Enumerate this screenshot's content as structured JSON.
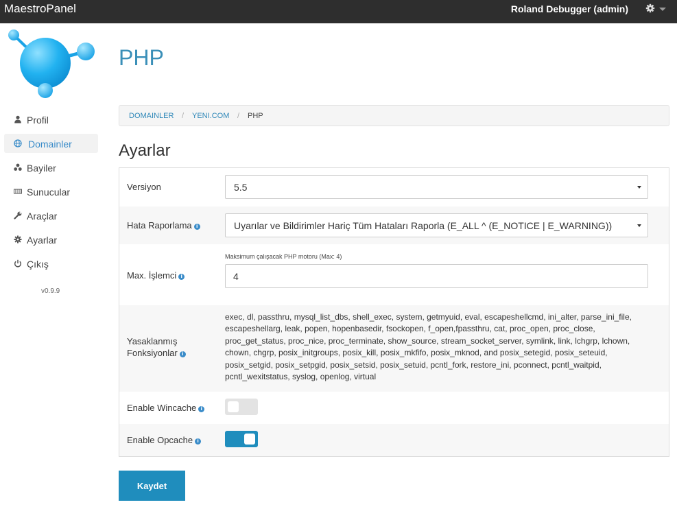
{
  "app": {
    "brand": "MaestroPanel",
    "user": "Roland Debugger (admin)"
  },
  "colors": {
    "topbar": "#2e2e2e",
    "accent": "#1f8dbd",
    "link": "#3a8cc9",
    "title": "#3a8fb8"
  },
  "sidebar": {
    "items": [
      {
        "label": "Profil",
        "icon": "user-icon",
        "active": false
      },
      {
        "label": "Domainler",
        "icon": "globe-icon",
        "active": true
      },
      {
        "label": "Bayiler",
        "icon": "sitemap-icon",
        "active": false
      },
      {
        "label": "Sunucular",
        "icon": "server-icon",
        "active": false
      },
      {
        "label": "Araçlar",
        "icon": "wrench-icon",
        "active": false
      },
      {
        "label": "Ayarlar",
        "icon": "gear-icon",
        "active": false
      },
      {
        "label": "Çıkış",
        "icon": "power-icon",
        "active": false
      }
    ],
    "version": "v0.9.9"
  },
  "page": {
    "title": "PHP"
  },
  "breadcrumb": {
    "item1": "DOMAINLER",
    "item2": "YENI.COM",
    "current": "PHP"
  },
  "settings": {
    "title": "Ayarlar",
    "version": {
      "label": "Versiyon",
      "value": "5.5"
    },
    "error_reporting": {
      "label": "Hata Raporlama",
      "value": "Uyarılar ve Bildirimler Hariç Tüm Hataları Raporla (E_ALL ^ (E_NOTICE | E_WARNING))"
    },
    "max_process": {
      "label": "Max. İşlemci",
      "help": "Maksimum çalışacak PHP motoru (Max: 4)",
      "value": "4"
    },
    "disabled_functions": {
      "label_line1": "Yasaklanmış",
      "label_line2": "Fonksiyonlar",
      "value": "exec, dl, passthru, mysql_list_dbs, shell_exec, system, getmyuid, eval, escapeshellcmd, ini_alter, parse_ini_file, escapeshellarg, leak, popen, hopenbasedir, fsockopen, f_open,fpassthru, cat, proc_open, proc_close, proc_get_status, proc_nice, proc_terminate, show_source, stream_socket_server, symlink, link, lchgrp, lchown, chown, chgrp, posix_initgroups, posix_kill, posix_mkfifo, posix_mknod, and posix_setegid, posix_seteuid, posix_setgid, posix_setpgid, posix_setsid, posix_setuid, pcntl_fork, restore_ini, pconnect, pcntl_waitpid, pcntl_wexitstatus, syslog, openlog, virtual"
    },
    "wincache": {
      "label": "Enable Wincache",
      "enabled": false
    },
    "opcache": {
      "label": "Enable Opcache",
      "enabled": true
    },
    "save_label": "Kaydet"
  }
}
